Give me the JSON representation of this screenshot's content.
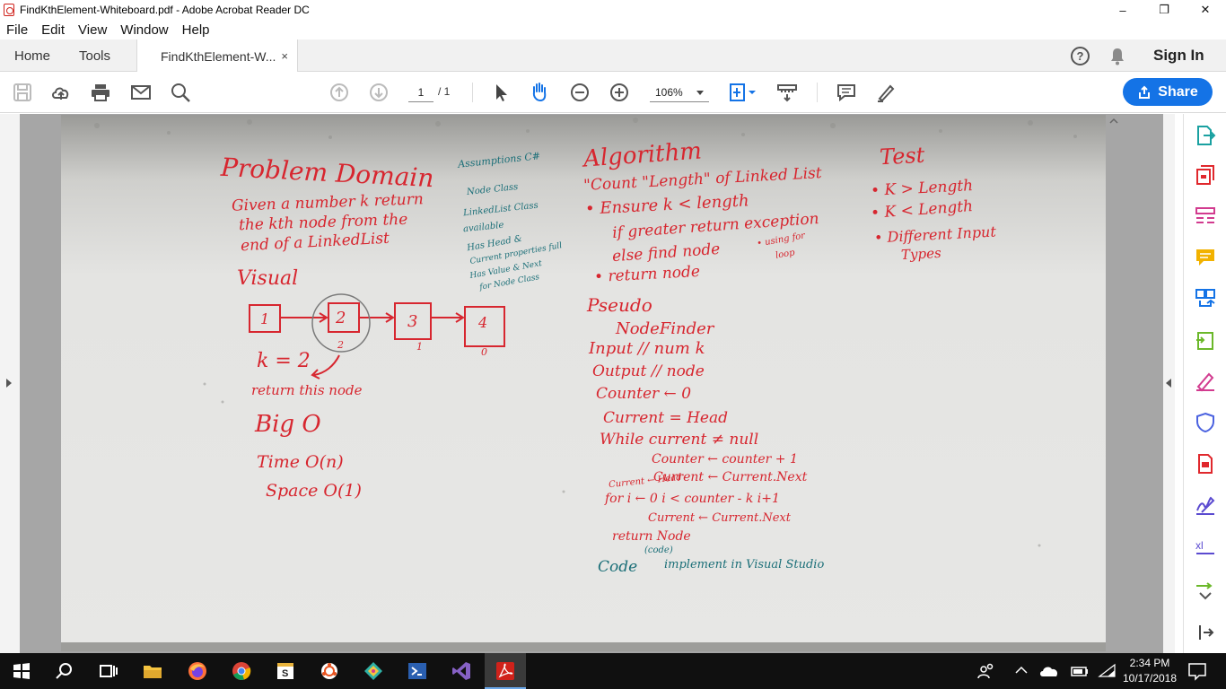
{
  "window": {
    "title": "FindKthElement-Whiteboard.pdf - Adobe Acrobat Reader DC",
    "minimize": "–",
    "maximize": "❐",
    "close": "✕"
  },
  "menu": [
    "File",
    "Edit",
    "View",
    "Window",
    "Help"
  ],
  "tabs": {
    "home": "Home",
    "tools": "Tools",
    "document": "FindKthElement-W...",
    "close": "×"
  },
  "header": {
    "help": "?",
    "sign_in": "Sign In"
  },
  "toolbar": {
    "page_current": "1",
    "page_total": "/ 1",
    "zoom": "106%",
    "share_label": "Share"
  },
  "whiteboard": {
    "problem_domain": {
      "title": "Problem Domain",
      "lines": [
        "Given a number k return",
        "the kth node from the",
        "end of a LinkedList"
      ]
    },
    "assumptions": {
      "title": "Assumptions C#",
      "lines": [
        "Node Class",
        "LinkedList Class",
        "available",
        "Has Head &",
        "Current properties full",
        "Has Value & Next",
        "for Node Class"
      ]
    },
    "algorithm": {
      "title": "Algorithm",
      "lines": [
        "\"Count \"Length\" of Linked List",
        "• Ensure k < length",
        "if greater return exception",
        "else find node",
        "• using for",
        "loop",
        "• return node"
      ]
    },
    "test": {
      "title": "Test",
      "lines": [
        "• K > Length",
        "• K < Length",
        "• Different Input",
        "Types"
      ]
    },
    "visual": {
      "title": "Visual",
      "nodes": [
        "1",
        "2",
        "3",
        "4"
      ],
      "indices": [
        "2",
        "1",
        "0"
      ],
      "k_label": "k = 2",
      "return_label": "return this node"
    },
    "big_o": {
      "title": "Big O",
      "time": "Time  O(n)",
      "space": "Space  O(1)"
    },
    "pseudo": {
      "title": "Pseudo",
      "lines": [
        "NodeFinder",
        "Input // num k",
        "Output // node",
        "Counter ← 0",
        "Current = Head",
        "While current ≠ null",
        "Counter ← counter + 1",
        "Current ← Current.Next",
        "Current ← Head",
        "for i ← 0  i < counter - k  i+1",
        "Current ← Current.Next",
        "return Node"
      ]
    },
    "code": {
      "label": "Code",
      "note": "(code)",
      "text": "implement in Visual Studio"
    }
  },
  "taskbar": {
    "time": "2:34 PM",
    "date": "10/17/2018"
  },
  "colors": {
    "share_blue": "#1473e6",
    "marker_red": "#d7262f",
    "marker_teal": "#1b6f78",
    "taskbar": "#101010"
  }
}
